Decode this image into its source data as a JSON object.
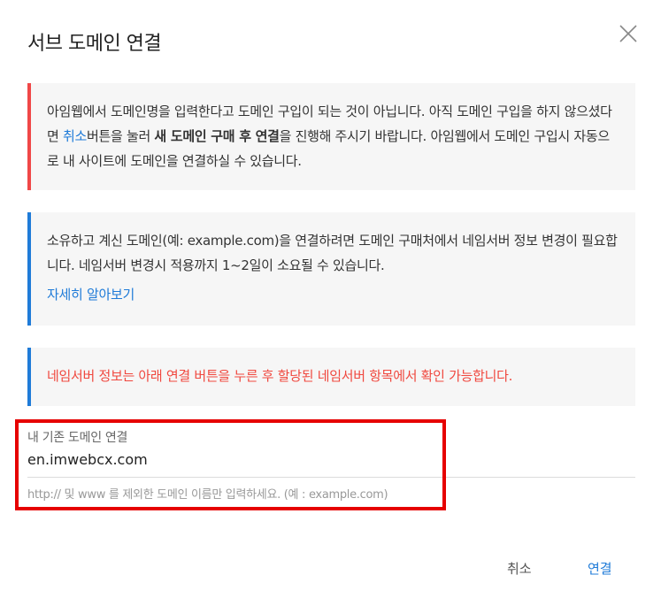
{
  "dialog": {
    "title": "서브 도메인 연결",
    "close_icon": "close-icon"
  },
  "notice_1": {
    "text_a": "아임웹에서 도메인명을 입력한다고 도메인 구입이 되는 것이 아닙니다. 아직 도메인 구입을 하지 않으셨다면 ",
    "cancel_link": "취소",
    "text_b": "버튼을 눌러 ",
    "bold": "새 도메인 구매 후 연결",
    "text_c": "을 진행해 주시기 바랍니다. 아임웹에서 도메인 구입시 자동으로 내 사이트에 도메인을 연결하실 수 있습니다."
  },
  "notice_2": {
    "text": "소유하고 계신 도메인(예: example.com)을 연결하려면 도메인 구매처에서 네임서버 정보 변경이 필요합니다. 네임서버 변경시 적용까지 1~2일이 소요될 수 있습니다.",
    "link": "자세히 알아보기"
  },
  "notice_3": {
    "text": "네임서버 정보는 아래 연결 버튼을 누른 후 할당된 네임서버 항목에서 확인 가능합니다."
  },
  "field": {
    "label": "내 기존 도메인 연결",
    "value": "en.imwebcx.com",
    "hint": "http:// 및 www 를 제외한 도메인 이름만 입력하세요. (예 : example.com)"
  },
  "buttons": {
    "cancel": "취소",
    "connect": "연결"
  },
  "colors": {
    "red_accent": "#f04747",
    "blue_accent": "#1f7bd8",
    "warning_text": "#f0483f",
    "highlight": "#e60000"
  }
}
